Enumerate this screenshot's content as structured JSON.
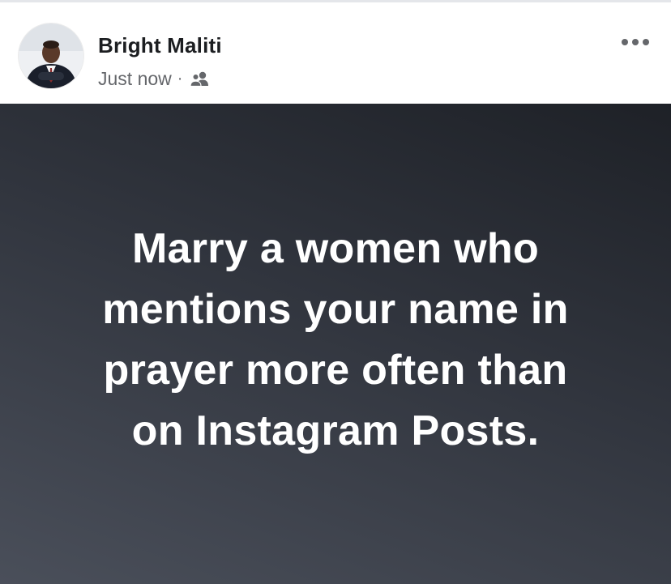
{
  "post": {
    "author_name": "Bright Maliti",
    "timestamp": "Just now",
    "separator": "·",
    "audience_icon": "friends-icon",
    "more_icon": "more-options-icon",
    "text_lines": [
      "Marry a women who",
      "mentions your name in",
      "prayer more often than",
      "on Instagram Posts."
    ],
    "background_colors": [
      "#1e2127",
      "#4a4f5a"
    ],
    "text_color": "#ffffff"
  }
}
